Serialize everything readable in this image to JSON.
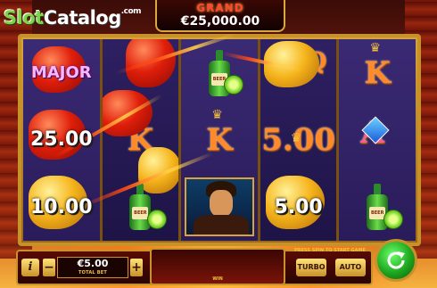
{
  "watermark": {
    "slot": "Slot",
    "catalog": "Catalog",
    "com": ".com"
  },
  "jackpot": {
    "label": "GRAND",
    "value": "€25,000.00"
  },
  "reels": [
    {
      "symbols": [
        "MAJOR",
        "25.00",
        "10.00"
      ]
    },
    {
      "symbols": [
        "red-pepper-icon",
        "K",
        "tequila-bottle-icon"
      ]
    },
    {
      "symbols": [
        "tequila-bottle-icon",
        "K",
        "hero-man-icon"
      ]
    },
    {
      "symbols": [
        "yellow-pepper-icon",
        "Q",
        "5.00"
      ]
    },
    {
      "symbols": [
        "K",
        "A",
        "tequila-bottle-icon"
      ]
    }
  ],
  "bottom_bar": {
    "info_label": "i",
    "minus_label": "−",
    "plus_label": "+",
    "bet_value": "€5.00",
    "bet_label": "TOTAL BET",
    "win_label": "WIN",
    "press_text": "PRESS SPIN TO START GAME",
    "turbo_label": "TURBO",
    "auto_label": "AUTO"
  },
  "bottle_label": "BEER",
  "colors": {
    "accent": "#c8922a",
    "spin": "#1ea61e",
    "grand": "#ff4a2a"
  }
}
